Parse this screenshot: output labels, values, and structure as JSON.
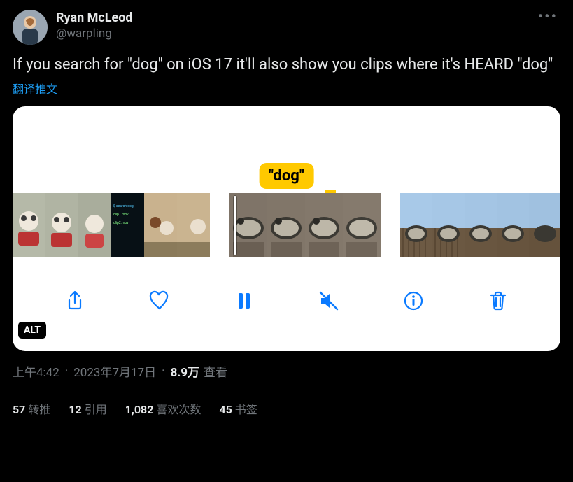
{
  "author": {
    "name": "Ryan McLeod",
    "handle": "@warpling"
  },
  "content": "If you search for \"dog\" on iOS 17 it'll also show you clips where it's HEARD \"dog\"",
  "translate_label": "翻译推文",
  "media": {
    "tag": "\"dog\"",
    "alt_badge": "ALT"
  },
  "meta": {
    "time": "上午4:42",
    "date": "2023年7月17日",
    "views_num": "8.9万",
    "views_label": "查看"
  },
  "stats": {
    "retweets_num": "57",
    "retweets_label": "转推",
    "quotes_num": "12",
    "quotes_label": "引用",
    "likes_num": "1,082",
    "likes_label": "喜欢次数",
    "bookmarks_num": "45",
    "bookmarks_label": "书签"
  }
}
